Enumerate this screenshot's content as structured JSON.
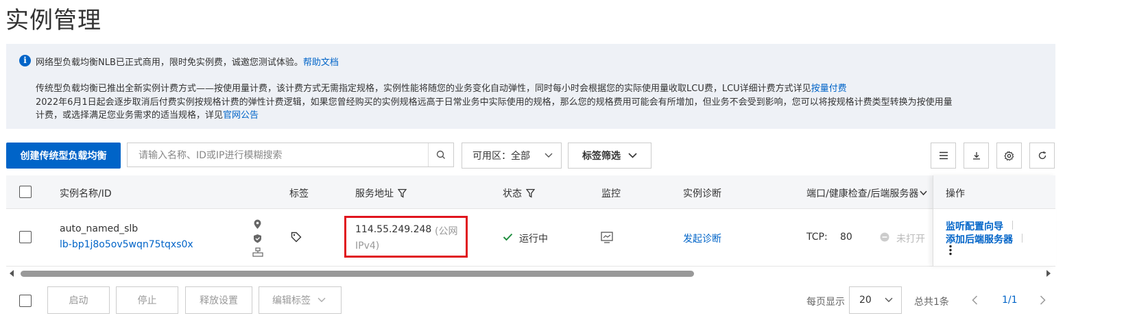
{
  "page": {
    "title": "实例管理"
  },
  "notice": {
    "line1": "网络型负载均衡NLB已正式商用，限时免实例费，诚邀您测试体验。",
    "line1_link": "帮助文档",
    "line2": "传统型负载均衡已推出全新实例计费方式——按使用量计费，该计费方式无需指定规格，实例性能将随您的业务变化自动弹性，同时每小时会根据您的实际使用量收取LCU费，LCU详细计费方式详见",
    "line2_link": "按量付费",
    "line3": "2022年6月1日起会逐步取消后付费实例按规格计费的弹性计费逻辑，如果您曾经购买的实例规格远高于日常业务中实际使用的规格，那么您的规格费用可能会有所增加，但业务不会受到影响，您可以将按规格计费类型转换为按使用量",
    "line4": "计费，或选择满足您业务需求的适当规格，详见",
    "line4_link": "官网公告"
  },
  "toolbar": {
    "create_label": "创建传统型负载均衡",
    "search_placeholder": "请输入名称、ID或IP进行模糊搜索",
    "zone_label": "可用区：",
    "zone_value": "全部",
    "tag_filter_label": "标签筛选"
  },
  "table": {
    "headers": {
      "name": "实例名称/ID",
      "tags": "标签",
      "address": "服务地址",
      "status": "状态",
      "monitor": "监控",
      "diagnosis": "实例诊断",
      "ports": "端口/健康检查/后端服务器",
      "ops": "操作"
    },
    "rows": [
      {
        "name": "auto_named_slb",
        "id": "lb-bp1j8o5ov5wqn75tqxs0x",
        "ip": "114.55.249.248",
        "ip_type_1": "(公网",
        "ip_type_2": "IPv4)",
        "status": "运行中",
        "diagnosis": "发起诊断",
        "protocol": "TCP:",
        "port": "80",
        "health": "未打开",
        "op1": "监听配置向导",
        "op2": "添加后端服务器"
      }
    ]
  },
  "footer": {
    "start": "启动",
    "stop": "停止",
    "release": "释放设置",
    "edit_tags": "编辑标签",
    "per_page_label": "每页显示",
    "per_page_value": "20",
    "total": "总共1条",
    "page": "1/1"
  },
  "colors": {
    "primary": "#0064c8",
    "highlight": "#e0141d",
    "success": "#1e8e3e"
  }
}
